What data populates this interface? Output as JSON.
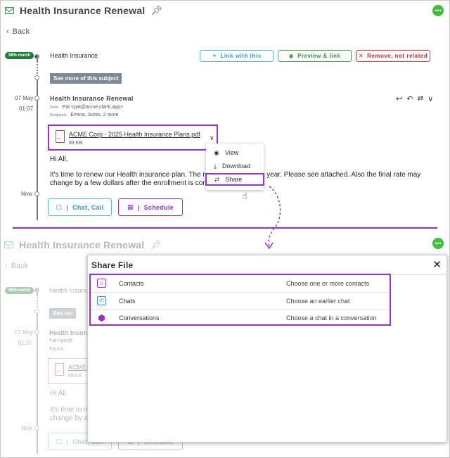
{
  "header": {
    "title": "Health Insurance Renewal",
    "back_label": "Back"
  },
  "thread": {
    "match_badge": "98% match",
    "subject_label": "Health Insurance",
    "link_button": "Link with this",
    "preview_button": "Preview & link",
    "remove_button": "Remove, not related",
    "see_more": "See more of this subject"
  },
  "email": {
    "date": "07 May",
    "time": "01:07",
    "now_label": "Now",
    "title": "Health Insurance Renewal",
    "from_label": "From",
    "from_value": "Pat <pat@acme.clariti.app>",
    "recipients_label": "Recipients",
    "recipients_value": "Emma, Justin,",
    "more_link": "2 more",
    "attachment_name": "ACME Corp - 2025 Health Insurance Plans.pdf",
    "attachment_size": "89 KB",
    "greeting": "Hi All,",
    "body_line1": "It's time to renew our Health insurance plan.  The ra",
    "body_line1_end": "% this year.  Please see attached.  Also the final rate may",
    "body_line2": "change by a few dollars after the enrollment is comp"
  },
  "context_menu": {
    "items": [
      "View",
      "Download",
      "Share"
    ]
  },
  "buttons": {
    "chat_call": "Chat, Call",
    "schedule": "Schedule"
  },
  "background": {
    "title": "Health Insurance Renewal",
    "back_label": "Back",
    "match_badge": "98% match",
    "subject_label": "Health Insura",
    "see_more": "See mo",
    "date": "07 May",
    "time": "01:07",
    "email_title": "Health Insura",
    "from_value": "Pat <pat@",
    "recipients_value": "Emma",
    "attachment_name": "ACME",
    "attachment_size": "89 KB",
    "greeting": "Hi All,",
    "body_line1": "It's time to re",
    "body_line2": "change by a f",
    "now_label": "Now",
    "chat_call": "Chat, Call",
    "schedule": "Schedule"
  },
  "share_modal": {
    "title": "Share File",
    "options": [
      {
        "label": "Contacts",
        "desc": "Choose one or more contacts",
        "icon": "contacts-icon"
      },
      {
        "label": "Chats",
        "desc": "Choose an earlier chat",
        "icon": "phone-chat-icon"
      },
      {
        "label": "Conversations",
        "desc": "Choose a chat in a conversation",
        "icon": "hexagon-icon"
      }
    ]
  },
  "colors": {
    "accent_purple": "#9b30d0",
    "match_green": "#1f7a3b",
    "link_blue": "#3a96c9",
    "remove_red": "#c92a2a"
  }
}
